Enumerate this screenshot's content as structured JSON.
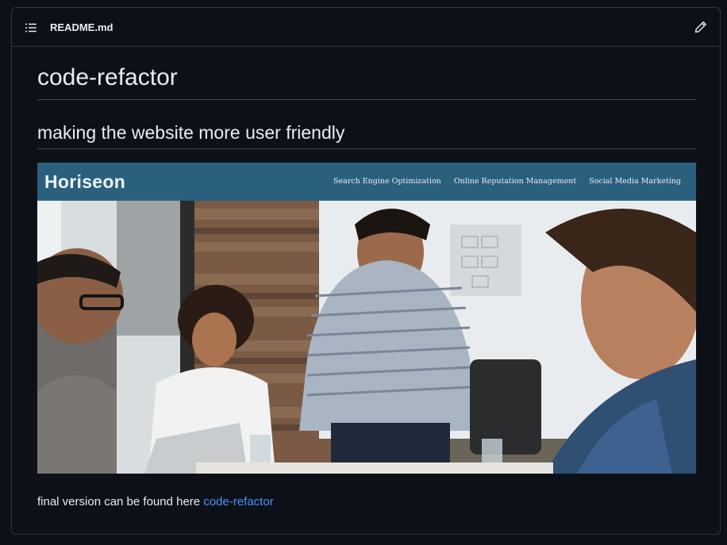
{
  "header": {
    "file_name": "README.md",
    "list_icon": "list-unordered-icon",
    "edit_icon": "pencil-icon"
  },
  "content": {
    "title": "code-refactor",
    "subtitle": "making the website more user friendly",
    "image": {
      "site_logo": "Horiseon",
      "nav": [
        "Search Engine Optimization",
        "Online Reputation Management",
        "Social Media Marketing"
      ]
    },
    "footer_text": "final version can be found here ",
    "footer_link": "code-refactor"
  },
  "colors": {
    "background": "#0d1117",
    "border": "#30363d",
    "link": "#4493f8",
    "site_header": "#2a607e"
  }
}
